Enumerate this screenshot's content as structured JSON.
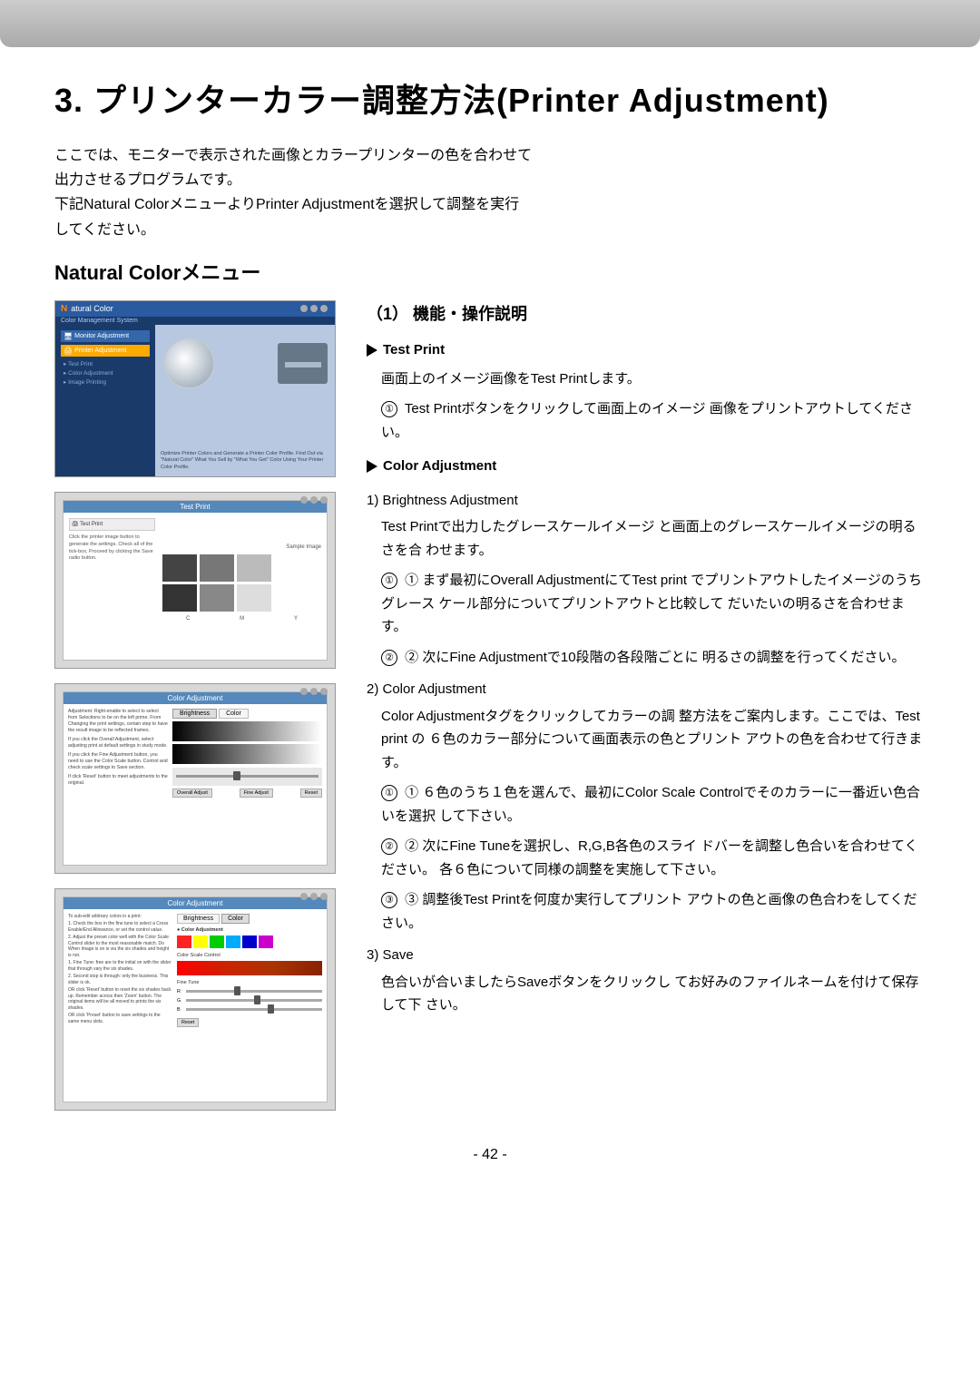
{
  "topBar": {
    "visible": true
  },
  "mainTitle": "3. プリンターカラー調整方法(Printer Adjustment)",
  "intro": {
    "line1": "ここでは、モニターで表示された画像とカラープリンターの色を合わせて",
    "line2": "出力させるプログラムです。",
    "line3": "下記Natural ColorメニューよりPrinter Adjustmentを選択して調整を実行",
    "line4": "してください。"
  },
  "sectionTitle": "Natural Colorメニュー",
  "stepNum": "（1） 機能・操作説明",
  "testPrint": {
    "title": "Test Print",
    "desc": "画面上のイメージ画像をTest Printします。",
    "step1": "Test Printボタンをクリックして画面上のイメージ 画像をプリントアウトしてください。"
  },
  "colorAdjustment": {
    "title": "Color Adjustment",
    "sub1": "1) Brightness Adjustment",
    "sub1desc": "Test Printで出力したグレースケールイメージ と画面上のグレースケールイメージの明るさを合 わせます。",
    "step1prefix": "① まず最初にOverall AdjustmentにてTest print でプリントアウトしたイメージのうちグレース ケール部分についてプリントアウトと比較して だいたいの明るさを合わせます。",
    "step2prefix": "② 次にFine Adjustmentで10段階の各段階ごとに 明るさの調整を行ってください。",
    "sub2": "2) Color Adjustment",
    "sub2desc": "Color Adjustmentタグをクリックしてカラーの調 整方法をご案内します。ここでは、Test print の ６色のカラー部分について画面表示の色とプリント アウトの色を合わせて行きます。",
    "step1color": "① ６色のうち１色を選んで、最初にColor Scale Controlでそのカラーに一番近い色合いを選択 して下さい。",
    "step2color": "② 次にFine Tuneを選択し、R,G,B各色のスライ ドバーを調整し色合いを合わせてください。 各６色について同様の調整を実施して下さい。",
    "step3color": "③ 調整後Test Printを何度か実行してプリント アウトの色と画像の色合わをしてください。",
    "sub3": "3) Save",
    "sub3desc": "色合いが合いましたらSaveボタンをクリックし てお好みのファイルネームを付けて保存して下 さい。"
  },
  "pageNum": "- 42 -",
  "screenshots": {
    "ss1": {
      "headerText": "Natural Color",
      "subText": "Color Management System",
      "menuItems": [
        "Monitor Adjustment",
        "Printer Adjustment",
        "Test Print",
        "Color Adjustment",
        "Image Printing"
      ],
      "mainText": "Optimize Printer Colors and Generate a Printer Color Profile. Find Out via \"Natural Color\" What You Sell by \"What You Get\" Color Using Your Printer Color Profile."
    },
    "ss2": {
      "title": "Test Print",
      "sampleText": "Sample Image"
    },
    "ss3": {
      "title": "Color Adjustment",
      "tabs": [
        "Brightness",
        "Color"
      ]
    },
    "ss4": {
      "title": "Color Adjustment",
      "tabs": [
        "Brightness",
        "Color"
      ],
      "colorSection": "Color Scale Control",
      "fineTune": "Fine Tune"
    }
  }
}
